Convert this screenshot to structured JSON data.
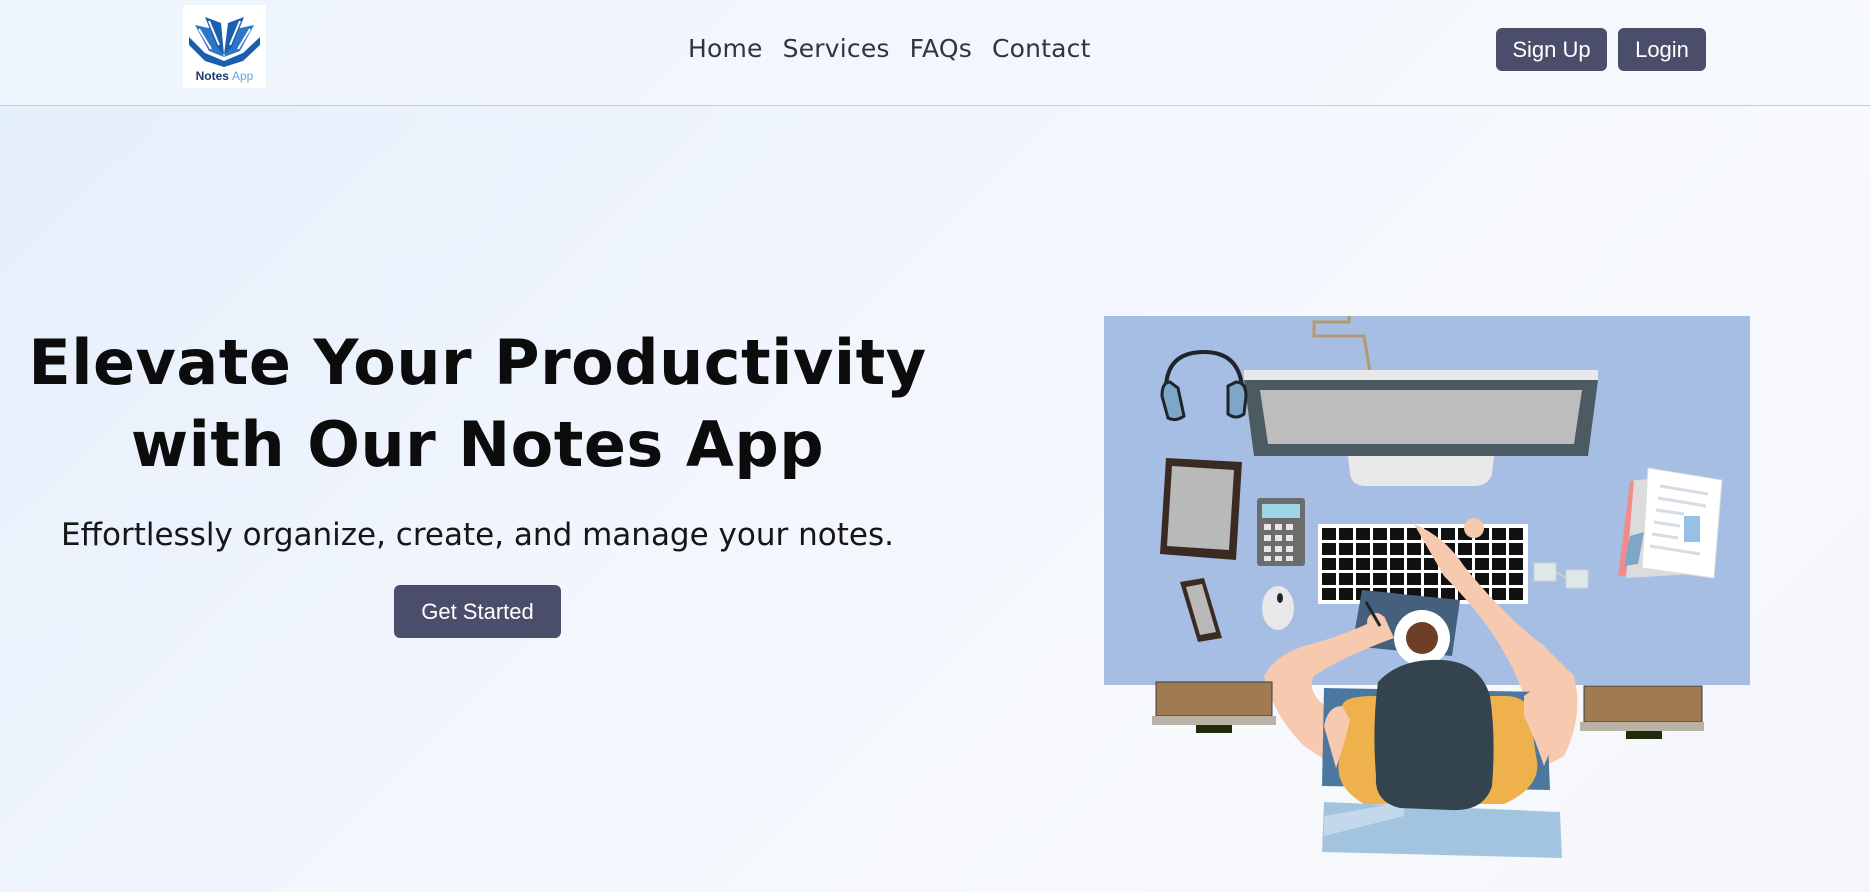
{
  "brand": {
    "logo_word1": "Notes",
    "logo_word2": "App"
  },
  "nav": {
    "links": [
      "Home",
      "Services",
      "FAQs",
      "Contact"
    ]
  },
  "auth": {
    "signup_label": "Sign Up",
    "login_label": "Login"
  },
  "hero": {
    "title_line1": "Elevate Your Productivity",
    "title_line2": "with Our Notes App",
    "subtitle": "Effortlessly organize, create, and manage your notes.",
    "cta_label": "Get Started"
  },
  "colors": {
    "button": "#4a4e6b",
    "desk": "#a6bee3",
    "logo_blue": "#1a5fae"
  },
  "icons": {
    "logo": "open-book-icon",
    "illustration": "person-at-desk-illustration"
  }
}
